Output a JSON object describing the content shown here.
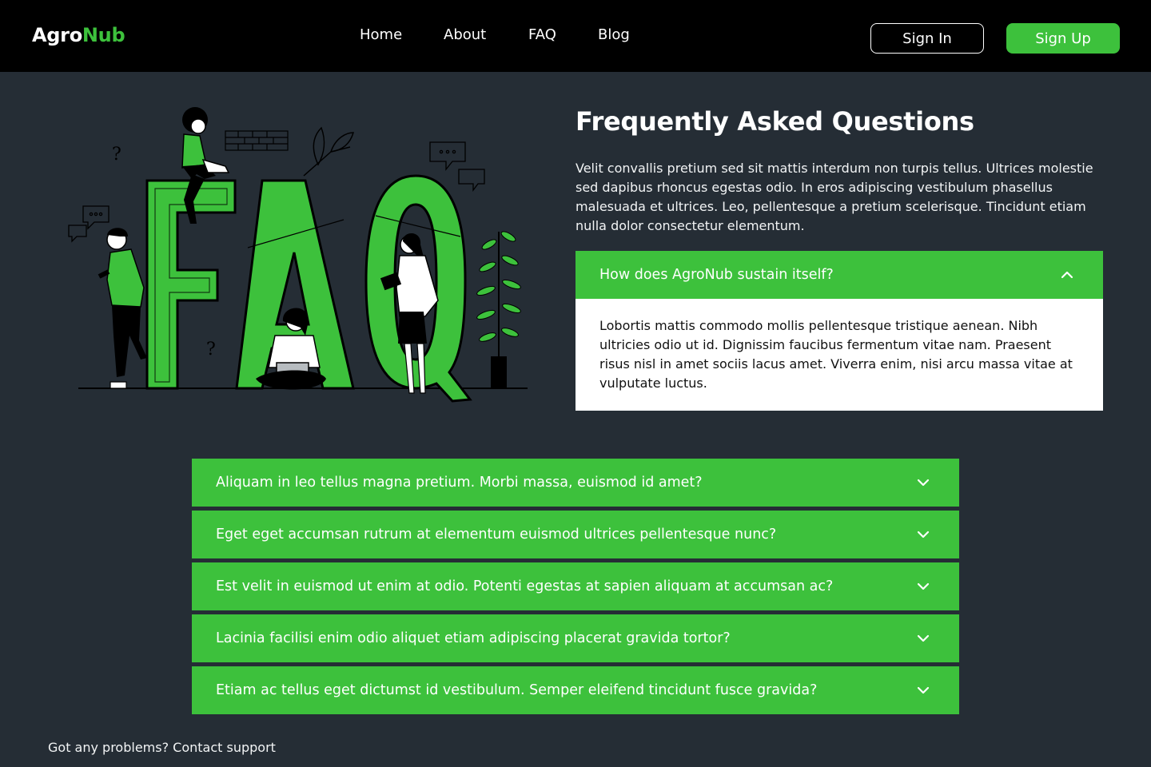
{
  "header": {
    "logo_part1": "Agro",
    "logo_part2": "Nub",
    "nav": [
      {
        "label": "Home"
      },
      {
        "label": "About"
      },
      {
        "label": "FAQ"
      },
      {
        "label": "Blog"
      }
    ],
    "sign_in_label": "Sign In",
    "sign_up_label": "Sign Up"
  },
  "colors": {
    "accent": "#3dc13c",
    "background": "#252d35",
    "header_bg": "#000000"
  },
  "faq": {
    "title": "Frequently Asked Questions",
    "intro": "Velit convallis pretium sed sit mattis interdum non turpis tellus. Ultrices molestie sed dapibus rhoncus egestas odio. In eros adipiscing vestibulum phasellus malesuada et ultrices. Leo, pellentesque a pretium scelerisque. Tincidunt etiam nulla dolor consectetur elementum.",
    "open_item": {
      "question": "How does AgroNub sustain itself?",
      "answer": "Lobortis mattis commodo mollis pellentesque tristique aenean. Nibh ultricies odio ut id. Dignissim faucibus fermentum vitae nam. Praesent risus nisl in amet sociis lacus amet. Viverra enim, nisi arcu massa vitae at vulputate luctus.",
      "icon": "chevron-up-icon"
    },
    "items": [
      {
        "question": "Aliquam in leo tellus magna pretium. Morbi massa, euismod id amet?",
        "icon": "chevron-down-icon"
      },
      {
        "question": "Eget eget accumsan rutrum at elementum euismod ultrices pellentesque nunc?",
        "icon": "chevron-down-icon"
      },
      {
        "question": "Est velit in euismod ut enim at odio. Potenti egestas at sapien aliquam at accumsan ac?",
        "icon": "chevron-down-icon"
      },
      {
        "question": "Lacinia facilisi enim odio aliquet etiam adipiscing placerat gravida tortor?",
        "icon": "chevron-down-icon"
      },
      {
        "question": "Etiam ac tellus eget dictumst id vestibulum. Semper eleifend tincidunt fusce gravida?",
        "icon": "chevron-down-icon"
      }
    ]
  },
  "illustration": {
    "letters": [
      "F",
      "A",
      "Q"
    ]
  },
  "footer": {
    "support_text": "Got any problems? Contact support"
  }
}
